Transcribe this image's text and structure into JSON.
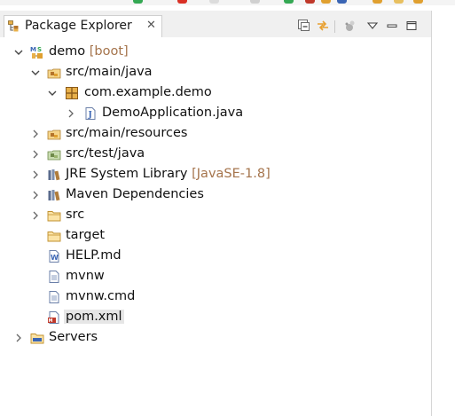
{
  "view": {
    "tab_title": "Package Explorer",
    "tab_close_icon": "close-icon",
    "toolbar": [
      {
        "name": "collapse-all-button",
        "icon": "collapse-all-icon"
      },
      {
        "name": "link-with-editor-button",
        "icon": "link-with-editor-icon"
      },
      {
        "name": "focus-on-active-task-button",
        "icon": "focus-task-icon"
      },
      {
        "name": "view-menu-button",
        "icon": "chevron-down-icon"
      },
      {
        "name": "minimize-button",
        "icon": "minimize-icon"
      },
      {
        "name": "maximize-button",
        "icon": "maximize-icon"
      }
    ]
  },
  "tree": {
    "project": {
      "label": "demo",
      "decoration": "[boot]",
      "expanded": true
    },
    "items": [
      {
        "label": "src/main/java",
        "expanded": true
      },
      {
        "label": "com.example.demo",
        "expanded": true
      },
      {
        "label": "DemoApplication.java",
        "expanded": false
      },
      {
        "label": "src/main/resources",
        "expanded": false
      },
      {
        "label": "src/test/java",
        "expanded": false
      },
      {
        "label": "JRE System Library",
        "decoration": "[JavaSE-1.8]",
        "expanded": false
      },
      {
        "label": "Maven Dependencies",
        "expanded": false
      },
      {
        "label": "src",
        "expanded": false
      },
      {
        "label": "target"
      },
      {
        "label": "HELP.md"
      },
      {
        "label": "mvnw"
      },
      {
        "label": "mvnw.cmd"
      },
      {
        "label": "pom.xml",
        "selected": true
      }
    ],
    "servers": {
      "label": "Servers",
      "expanded": false
    }
  },
  "colors": {
    "decoration": "#a5744c",
    "selection": "#e6e6e6",
    "folder": "#e8b04a",
    "package": "#b5742b",
    "java_blue": "#3a65b4"
  }
}
